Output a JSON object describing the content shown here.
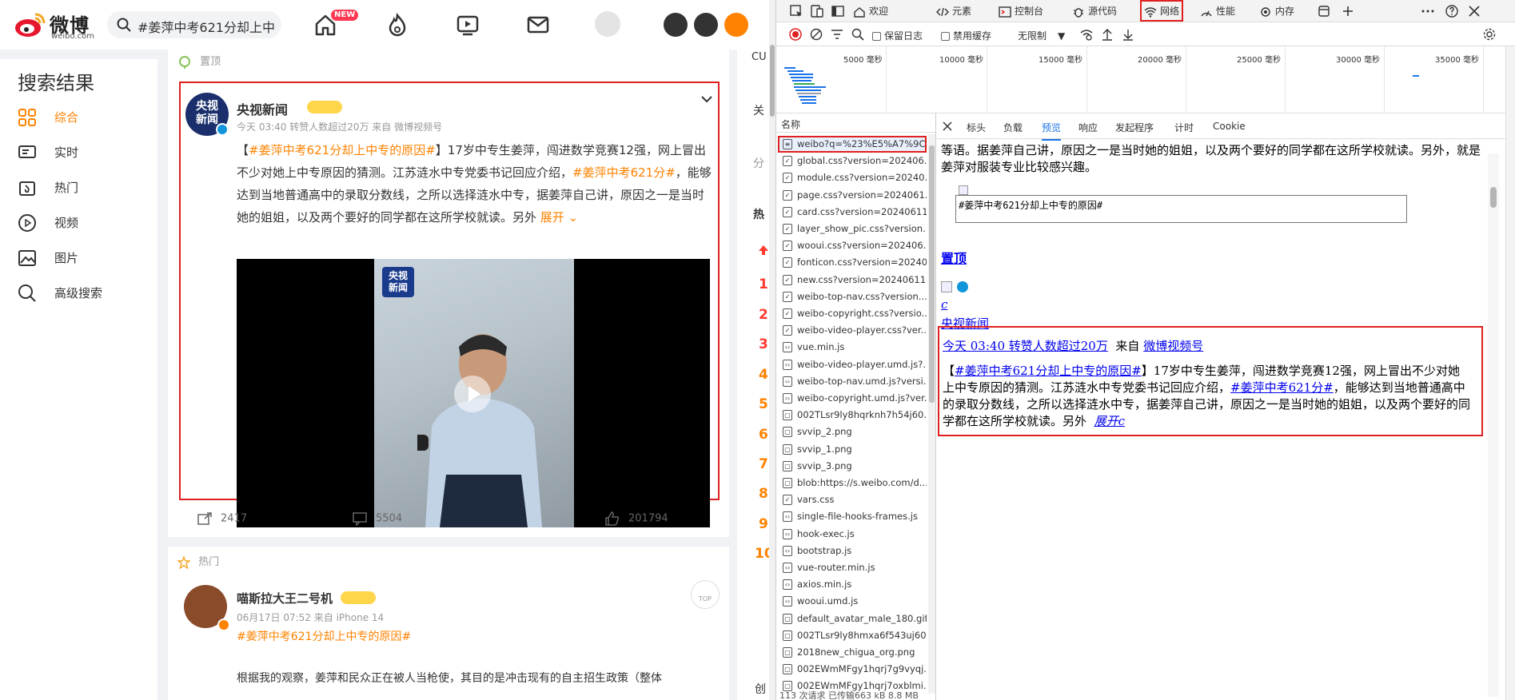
{
  "weibo": {
    "logo_text": "微博",
    "logo_sub": "weibo.com",
    "search_query": "#姜萍中考621分却上中",
    "new_badge": "NEW",
    "left_panel": {
      "title": "搜索结果",
      "items": [
        {
          "label": "综合",
          "icon": "grid-icon",
          "active": true
        },
        {
          "label": "实时",
          "icon": "chat-icon"
        },
        {
          "label": "热门",
          "icon": "hot-icon"
        },
        {
          "label": "视频",
          "icon": "play-circle-icon"
        },
        {
          "label": "图片",
          "icon": "image-icon"
        },
        {
          "label": "高级搜索",
          "icon": "search-icon"
        }
      ]
    },
    "card1": {
      "pin_label": "置顶",
      "author": "央视新闻",
      "avatar_text": "央视\n新闻",
      "meta": "今天 03:40 转赞人数超过20万  来自 微博视频号",
      "text_prefix": "【",
      "hashtag1": "#姜萍中考621分却上中专的原因#",
      "text_mid": "】17岁中专生姜萍，闯进数学竞赛12强，网上冒出不少对她上中专原因的猜测。江苏涟水中专党委书记回应介绍，",
      "hashtag2": "#姜萍中考621分#",
      "text_end": "，能够达到当地普通高中的录取分数线，之所以选择涟水中专，据姜萍自己讲，原因之一是当时她的姐姐，以及两个要好的同学都在这所学校就读。另外",
      "expand": "展开",
      "video_logo": "央视\n新闻",
      "reposts": "2417",
      "comments": "5504",
      "likes": "201794"
    },
    "card2": {
      "hot_label": "热门",
      "author": "喵斯拉大王二号机",
      "meta": "06月17日 07:52  来自 iPhone 14",
      "hashtag": "#姜萍中考621分却上中专的原因#",
      "text": "根据我的观察，姜萍和民众正在被人当枪使，其目的是冲击现有的自主招生政策（整体",
      "top_label": "TOP"
    },
    "right_col": {
      "cu": "CU",
      "guan": "关",
      "fen": "分",
      "re": "热",
      "nums": [
        "1",
        "2",
        "3",
        "4",
        "5",
        "6",
        "7",
        "8",
        "9",
        "10"
      ],
      "chuang": "创"
    }
  },
  "devtools": {
    "tabs": [
      {
        "label": "欢迎",
        "icon": "home-icon"
      },
      {
        "label": "元素",
        "icon": "code-icon"
      },
      {
        "label": "控制台",
        "icon": "console-icon"
      },
      {
        "label": "源代码",
        "icon": "bug-icon"
      },
      {
        "label": "网络",
        "icon": "wifi-icon",
        "active": true
      },
      {
        "label": "性能",
        "icon": "performance-icon"
      },
      {
        "label": "内存",
        "icon": "memory-icon"
      }
    ],
    "toolbar": {
      "preserve_log": "保留日志",
      "disable_cache": "禁用缓存",
      "throttle": "无限制"
    },
    "timeline_labels": [
      "5000 毫秒",
      "10000 毫秒",
      "15000 毫秒",
      "20000 毫秒",
      "25000 毫秒",
      "30000 毫秒",
      "35000 毫秒"
    ],
    "list_header": "名称",
    "requests": [
      {
        "name": "weibo?q=%23%E5%A7%9C...",
        "type": "doc",
        "selected": true
      },
      {
        "name": "global.css?version=202406...",
        "type": "css"
      },
      {
        "name": "module.css?version=20240...",
        "type": "css"
      },
      {
        "name": "page.css?version=2024061...",
        "type": "css"
      },
      {
        "name": "card.css?version=20240611...",
        "type": "css"
      },
      {
        "name": "layer_show_pic.css?version...",
        "type": "css"
      },
      {
        "name": "wooui.css?version=202406...",
        "type": "css"
      },
      {
        "name": "fonticon.css?version=20240...",
        "type": "css"
      },
      {
        "name": "new.css?version=20240611...",
        "type": "css"
      },
      {
        "name": "weibo-top-nav.css?version...",
        "type": "css"
      },
      {
        "name": "weibo-copyright.css?versio...",
        "type": "css"
      },
      {
        "name": "weibo-video-player.css?ver...",
        "type": "css"
      },
      {
        "name": "vue.min.js",
        "type": "js"
      },
      {
        "name": "weibo-video-player.umd.js?...",
        "type": "js"
      },
      {
        "name": "weibo-top-nav.umd.js?versi...",
        "type": "js"
      },
      {
        "name": "weibo-copyright.umd.js?ver...",
        "type": "js"
      },
      {
        "name": "002TLsr9ly8hqrknh7h54j60...",
        "type": "img"
      },
      {
        "name": "svvip_2.png",
        "type": "img"
      },
      {
        "name": "svvip_1.png",
        "type": "img"
      },
      {
        "name": "svvip_3.png",
        "type": "img"
      },
      {
        "name": "blob:https://s.weibo.com/d...",
        "type": "img"
      },
      {
        "name": "vars.css",
        "type": "css"
      },
      {
        "name": "single-file-hooks-frames.js",
        "type": "js"
      },
      {
        "name": "hook-exec.js",
        "type": "js"
      },
      {
        "name": "bootstrap.js",
        "type": "js"
      },
      {
        "name": "vue-router.min.js",
        "type": "js"
      },
      {
        "name": "axios.min.js",
        "type": "js"
      },
      {
        "name": "wooui.umd.js",
        "type": "js"
      },
      {
        "name": "default_avatar_male_180.gif...",
        "type": "img"
      },
      {
        "name": "002TLsr9ly8hmxa6f543uj60...",
        "type": "img"
      },
      {
        "name": "2018new_chigua_org.png",
        "type": "img"
      },
      {
        "name": "002EWmMFgy1hqrj7g9vyqj...",
        "type": "img"
      },
      {
        "name": "002EWmMFgy1hqrj7oxblmi...",
        "type": "img"
      }
    ],
    "status_line": "113 次请求  已传输663 kB  8.8 MB",
    "preview_tabs": [
      {
        "label": "标头"
      },
      {
        "label": "负载"
      },
      {
        "label": "预览",
        "active": true
      },
      {
        "label": "响应"
      },
      {
        "label": "发起程序"
      },
      {
        "label": "计时"
      },
      {
        "label": "Cookie"
      }
    ],
    "preview": {
      "top_text": "等语。据姜萍自己讲，原因之一是当时她的姐姐，以及两个要好的同学都在这所学校就读。另外，就是姜萍对服装专业比较感兴趣。",
      "textarea_value": "#姜萍中考621分却上中专的原因#",
      "pin_link": "置顶",
      "c_link": "c",
      "author_link": "央视新闻",
      "time_link": "今天 03:40 转赞人数超过20万",
      "from_text": "来自",
      "source_link": "微博视频号",
      "body_prefix": "【",
      "hashtag1": "#姜萍中考621分却上中专的原因#",
      "body_mid": "】17岁中专生姜萍，闯进数学竞赛12强，网上冒出不少对她上中专原因的猜测。江苏涟水中专党委书记回应介绍，",
      "hashtag2": "#姜萍中考621分#",
      "body_end": "，能够达到当地普通高中的录取分数线，之所以选择涟水中专，据姜萍自己讲，原因之一是当时她的姐姐，以及两个要好的同学都在这所学校就读。另外",
      "expand_link": "展开c"
    }
  }
}
